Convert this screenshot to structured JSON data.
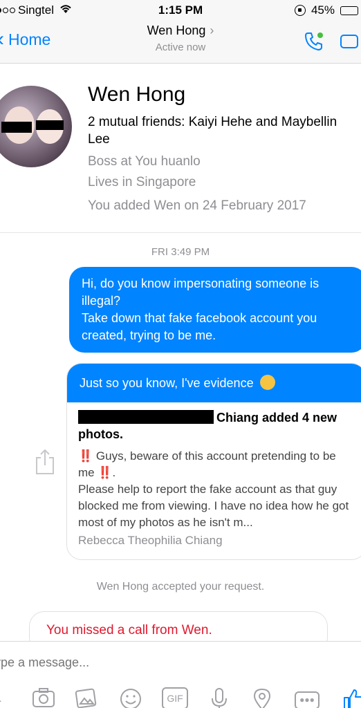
{
  "status_bar": {
    "carrier": "Singtel",
    "time": "1:15 PM",
    "battery": "45%"
  },
  "nav": {
    "back_label": "Home",
    "title": "Wen Hong",
    "subtitle": "Active now"
  },
  "profile": {
    "name": "Wen Hong",
    "mutual": "2 mutual friends: Kaiyi Hehe and Maybellin Lee",
    "work": "Boss at You huanlo",
    "location": "Lives in Singapore",
    "added": "You added Wen on 24 February 2017"
  },
  "conversation": {
    "date_separator": "FRI 3:49 PM",
    "message_1": "Hi, do you know impersonating someone is illegal?\nTake down that fake facebook account you created, trying to be me.",
    "share_header": "Just so you know, I've evidence",
    "share_title": "Chiang added 4 new photos.",
    "share_text_a": "Guys, beware of this account pretending to be me",
    "share_bang": "‼️",
    "share_text_b": "Please help to report the fake account as that guy blocked me from viewing. I have no idea how he got most of my photos as he isn't m...",
    "share_author": "Rebecca Theophilia Chiang",
    "accepted": "Wen Hong accepted your request.",
    "missed_call": "You missed a call from Wen."
  },
  "composer": {
    "placeholder": "ype a message..."
  },
  "colors": {
    "accent": "#0084ff",
    "missed": "#e0182d",
    "muted": "#8e8e93"
  },
  "icons": [
    "wifi-icon",
    "phone-icon",
    "video-icon",
    "share-icon",
    "camera-icon",
    "photo-icon",
    "emoji-icon",
    "gif-icon",
    "mic-icon",
    "location-icon",
    "more-icon",
    "like-icon"
  ]
}
